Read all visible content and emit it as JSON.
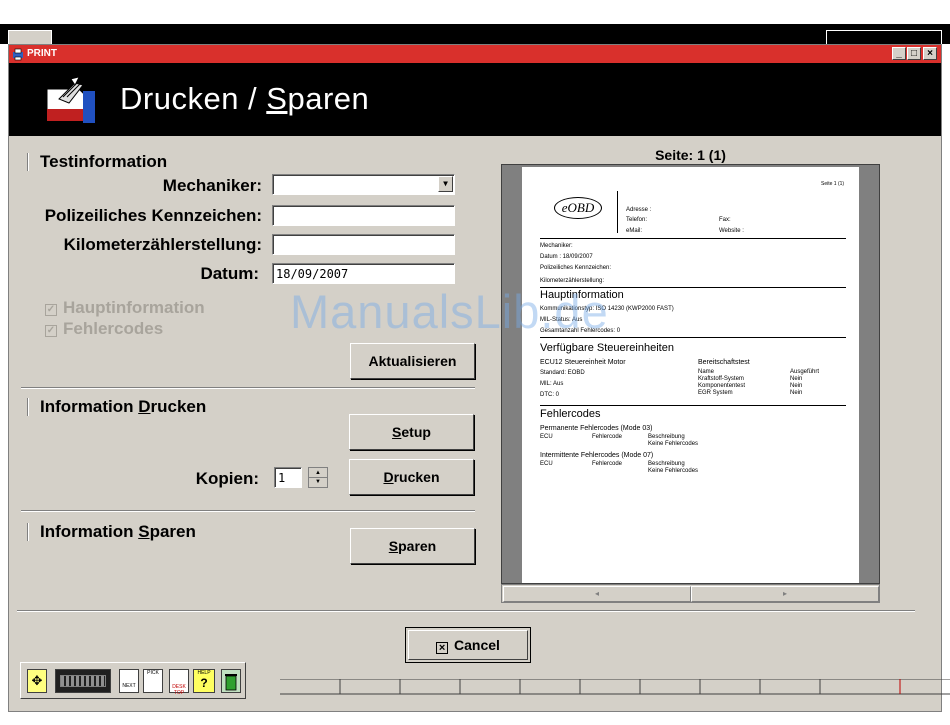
{
  "window": {
    "title": "PRINT",
    "minimize": "_",
    "maximize": "□",
    "close": "×"
  },
  "banner": {
    "title_prefix": "Drucken / ",
    "title_underlined": "S",
    "title_suffix": "paren"
  },
  "test_info": {
    "title": "Testinformation",
    "mechanic_label": "Mechaniker:",
    "mechanic_value": "",
    "plate_label": "Polizeiliches Kennzeichen:",
    "plate_value": "",
    "odometer_label": "Kilometerzählerstellung:",
    "odometer_value": "",
    "date_label": "Datum:",
    "date_value": "18/09/2007",
    "check_main": "Hauptinformation",
    "check_errors": "Fehlercodes",
    "update_button": "Aktualisieren"
  },
  "print_info": {
    "title_prefix": "Information ",
    "title_underlined": "D",
    "title_suffix": "rucken",
    "setup_underlined": "S",
    "setup_suffix": "etup",
    "copies_label": "Kopien:",
    "copies_value": "1",
    "print_underlined": "D",
    "print_suffix": "rucken"
  },
  "save_info": {
    "title_prefix": "Information ",
    "title_underlined": "S",
    "title_suffix": "paren",
    "save_underlined": "S",
    "save_suffix": "paren"
  },
  "preview": {
    "page_label": "Seite: 1 (1)",
    "page_corner": "Seite 1 (1)",
    "logo": "eOBD",
    "adresse": "Adresse :",
    "telefon": "Telefon:",
    "fax": "Fax:",
    "email": "eMail:",
    "website": "Website :",
    "mechaniker": "Mechaniker:",
    "datum": "Datum : 18/09/2007",
    "kennzeichen": "Polizeiliches Kennzeichen:",
    "kilometer": "Kilometerzählerstellung:",
    "haupt_title": "Hauptinformation",
    "kommunikation": "Kommunikationstyp: ISO 14230 (KWP2000 FAST)",
    "mil_status": "MIL-Status: Aus",
    "gesamt": "Gesamtanzahl Fehlercodes: 0",
    "verfuegbar_title": "Verfügbare Steuereinheiten",
    "ecu12": "ECU12 Steuereinheit Motor",
    "standard": "Standard: EOBD",
    "mil": "MIL: Aus",
    "dtc": "DTC: 0",
    "bereit_title": "Bereitschaftstest",
    "name_col": "Name",
    "ausg_col": "Ausgeführt",
    "r1": "Kraftstoff-System",
    "r2": "Komponententest",
    "r3": "EGR System",
    "nein": "Nein",
    "fehler_title": "Fehlercodes",
    "perm_title": "Permanente Fehlercodes (Mode 03)",
    "inter_title": "Intermittente Fehlercodes (Mode 07)",
    "ecu_col": "ECU",
    "fc_col": "Fehlercode",
    "beschr_col": "Beschreibung",
    "keine": "Keine Fehlercodes",
    "scroll_left": "◂",
    "scroll_right": "▸"
  },
  "cancel_button": "Cancel",
  "cancel_icon": "×",
  "watermark": "ManualsLib.de",
  "taskbar": {
    "next": "NEXT",
    "pick": "PICK",
    "desk": "DESK TOP",
    "help": "HELP",
    "help_q": "?"
  },
  "colors": {
    "titlebar": "#d9302c",
    "window_bg": "#d4d0c8",
    "banner": "#000000"
  }
}
